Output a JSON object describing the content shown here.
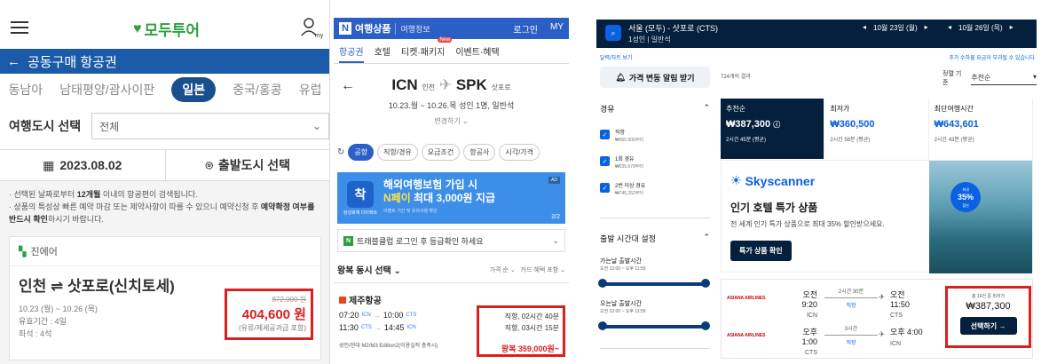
{
  "modoo": {
    "logo": "모두투어",
    "my_label": "my",
    "page_title": "공동구매 항공권",
    "regions": [
      "동남아",
      "남태평양/괌사이판",
      "일본",
      "중국/홍콩",
      "유럽"
    ],
    "selected_region": "일본",
    "city_label": "여행도시 선택",
    "city_select": "전체",
    "date": "2023.08.02",
    "departure_city": "출발도시 선택",
    "note1_a": "· 선택된 날짜로부터 ",
    "note1_b": "12개월",
    "note1_c": " 이내의 항공편이 검색됩니다.",
    "note2_a": "· 상품의 특성상 빠른 예약 마감 또는 제약사항이 따를 수 있으니 예약신청 후 ",
    "note2_b": "예약확정 여부를 반드시 확인",
    "note2_c": "하시기 바랍니다.",
    "airline": "진에어",
    "route": "인천 ⇌ 삿포로(신치토세)",
    "dates": "10.23 (월) ~ 10.26 (목)",
    "validity": "유효기간 : 4일",
    "seats": "좌석 : 4석",
    "old_price": "872,000 원",
    "price": "404,600 원",
    "tax_note": "(유류/제세공과금 포함)"
  },
  "naver": {
    "brand": "N",
    "title": "여행상품",
    "subtitle": "여행정보",
    "login": "로그인",
    "my": "MY",
    "tabs": [
      "항공권",
      "호텔",
      "티켓·패키지",
      "이벤트·혜택"
    ],
    "new_badge": "New",
    "origin": "ICN",
    "origin_name": "인천",
    "dest": "SPK",
    "dest_name": "삿포로",
    "trip_info": "10.23.월 ~ 10.26.목   성인 1명, 일반석",
    "change": "변경하기 ⌄",
    "filters": [
      "공항",
      "직항/경유",
      "요금조건",
      "항공사",
      "시각/가격"
    ],
    "banner_icon_text": "착",
    "banner_icon_caption": "삼성화재 다이렉트",
    "banner_line1": "해외여행보험 가입 시",
    "banner_line2_hl": "N페이 ",
    "banner_line2": "최대 3,000원 지급",
    "banner_small": "이벤트 기간 및 유의사항 확인",
    "banner_ad": "AD",
    "banner_page": "2/2",
    "login_box_brand": "N",
    "login_box_text": "트래블클럽 로그인 후 등급확인 하세요",
    "sort_label": "왕복 동시 선택",
    "sort_opt1": "가격 순 ⌄",
    "sort_opt2": "카드 혜택 포함 ⌄",
    "airline": "제주항공",
    "leg1_dep": "07:20",
    "leg1_from": "ICN",
    "leg1_arr": "10:00",
    "leg1_to": "CTS",
    "leg2_dep": "11:30",
    "leg2_from": "CTS",
    "leg2_arr": "14:45",
    "leg2_to": "ICN",
    "fare_note": "성인/현대 M2/M3 Edition2(이용실적 충족시)",
    "leg1_info": "직항, 02시간 40분",
    "leg2_info": "직항, 03시간 15분",
    "price": "왕복 359,000원~"
  },
  "skyscanner": {
    "route": "서울 (모두) - 삿포로 (CTS)",
    "pax": "1성인 | 일반석",
    "date1": "10월 23일 (월)",
    "date2": "10월 26일 (목)",
    "link_left": "달력/차트 보기",
    "link_right": "추가 수하물 요금이 부과될 수 있습니다",
    "alert_btn": "가격 변동 알림 받기",
    "results": "724개의 결과",
    "sort_label": "정렬 기준",
    "sort_value": "추천순",
    "stops_title": "경유",
    "stops": [
      {
        "label": "직항",
        "price": "₩360,500부터"
      },
      {
        "label": "1회 경유",
        "price": "₩535,679부터"
      },
      {
        "label": "2번 이상 경유",
        "price": "₩745,252부터"
      }
    ],
    "time_title": "출발 시간대 설정",
    "out_label": "가는날 출발시간",
    "out_range": "오전 12:00 ~ 오후 11:59",
    "ret_label": "오는날 출발시간",
    "ret_range": "오전 12:00 ~ 오후 11:59",
    "tabs": [
      {
        "label": "추천순",
        "price": "₩387,300",
        "dur": "2시간 45분 (평균)"
      },
      {
        "label": "최저가",
        "price": "₩360,500",
        "dur": "2시간 58분 (평균)"
      },
      {
        "label": "최단여행시간",
        "price": "₩643,601",
        "dur": "2시간 43분 (평균)"
      }
    ],
    "ad_brand": "Skyscanner",
    "ad_title": "인기 호텔 특가 상품",
    "ad_desc": "전 세계 인기 특가 상품으로 최대 35% 할인받으세요.",
    "ad_btn": "특가 상품 확인",
    "ad_badge_top": "최대",
    "ad_badge_pct": "35%",
    "ad_badge_bot": "할인",
    "airline_name": "ASIANA AIRLINES",
    "out_dep": "오전 9:20",
    "out_from": "ICN",
    "out_dur": "2시간 30분",
    "out_stop": "직항",
    "out_arr": "오전 11:50",
    "out_to": "CTS",
    "ret_dep": "오후 1:00",
    "ret_from": "CTS",
    "ret_dur": "3시간",
    "ret_stop": "직항",
    "ret_arr": "오후 4:00",
    "ret_to": "ICN",
    "deal_label": "총 19건 중 최저가",
    "price": "₩387,300",
    "select_btn": "선택하기 →"
  }
}
